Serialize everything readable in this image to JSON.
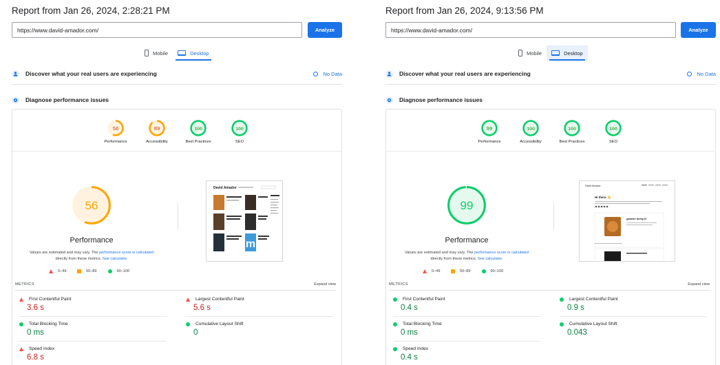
{
  "left": {
    "title": "Report from Jan 26, 2024, 2:28:21 PM",
    "url": "https://www.david-amador.com/",
    "analyze_label": "Analyze",
    "tabs": {
      "mobile": "Mobile",
      "desktop": "Desktop"
    },
    "users_section": "Discover what your real users are experiencing",
    "no_data": "No Data",
    "diagnose_section": "Diagnose performance issues",
    "scores": [
      {
        "value": "56",
        "label": "Performance",
        "status": "average"
      },
      {
        "value": "89",
        "label": "Accessibility",
        "status": "average"
      },
      {
        "value": "100",
        "label": "Best Practices",
        "status": "pass"
      },
      {
        "value": "100",
        "label": "SEO",
        "status": "pass"
      }
    ],
    "main_score": "56",
    "main_label": "Performance",
    "note_prefix": "Values are estimated and may vary. The ",
    "note_link": "performance score is calculated",
    "note_mid": " directly from these metrics. ",
    "note_link2": "See calculator.",
    "legend": [
      "0–49",
      "50–89",
      "90–100"
    ],
    "metrics_label": "METRICS",
    "expand_label": "Expand view",
    "metrics": [
      {
        "name": "First Contentful Paint",
        "value": "3.6 s",
        "status": "bad"
      },
      {
        "name": "Largest Contentful Paint",
        "value": "5.6 s",
        "status": "bad"
      },
      {
        "name": "Total Blocking Time",
        "value": "0 ms",
        "status": "good"
      },
      {
        "name": "Cumulative Layout Shift",
        "value": "0",
        "status": "good"
      },
      {
        "name": "Speed Index",
        "value": "6.8 s",
        "status": "bad"
      }
    ],
    "thumb": {
      "site_name": "David Amador"
    }
  },
  "right": {
    "title": "Report from Jan 26, 2024, 9:13:56 PM",
    "url": "https://www.david-amador.com/",
    "analyze_label": "Analyze",
    "tabs": {
      "mobile": "Mobile",
      "desktop": "Desktop"
    },
    "users_section": "Discover what your real users are experiencing",
    "no_data": "No Data",
    "diagnose_section": "Diagnose performance issues",
    "scores": [
      {
        "value": "99",
        "label": "Performance",
        "status": "pass"
      },
      {
        "value": "100",
        "label": "Accessibility",
        "status": "pass"
      },
      {
        "value": "100",
        "label": "Best Practices",
        "status": "pass"
      },
      {
        "value": "100",
        "label": "SEO",
        "status": "pass"
      }
    ],
    "main_score": "99",
    "main_label": "Performance",
    "note_prefix": "Values are estimated and may vary. The ",
    "note_link": "performance score is calculated",
    "note_mid": " directly from these metrics. ",
    "note_link2": "See calculator.",
    "legend": [
      "0–49",
      "50–89",
      "90–100"
    ],
    "metrics_label": "METRICS",
    "expand_label": "Expand view",
    "metrics": [
      {
        "name": "First Contentful Paint",
        "value": "0.4 s",
        "status": "good"
      },
      {
        "name": "Largest Contentful Paint",
        "value": "0.9 s",
        "status": "good"
      },
      {
        "name": "Total Blocking Time",
        "value": "0 ms",
        "status": "good"
      },
      {
        "name": "Cumulative Layout Shift",
        "value": "0.043",
        "status": "good"
      },
      {
        "name": "Speed Index",
        "value": "0.4 s",
        "status": "good"
      }
    ],
    "thumb": {
      "site_name": "David Amador",
      "greeting": "Hi there 👋",
      "post_title": "gamedev during 25"
    }
  },
  "colors": {
    "accent": "#1a73e8",
    "fail": "#ff4e42",
    "average": "#ffa400",
    "pass": "#0cce6b",
    "bad_text": "#c5221f",
    "good_text": "#0b8043"
  }
}
